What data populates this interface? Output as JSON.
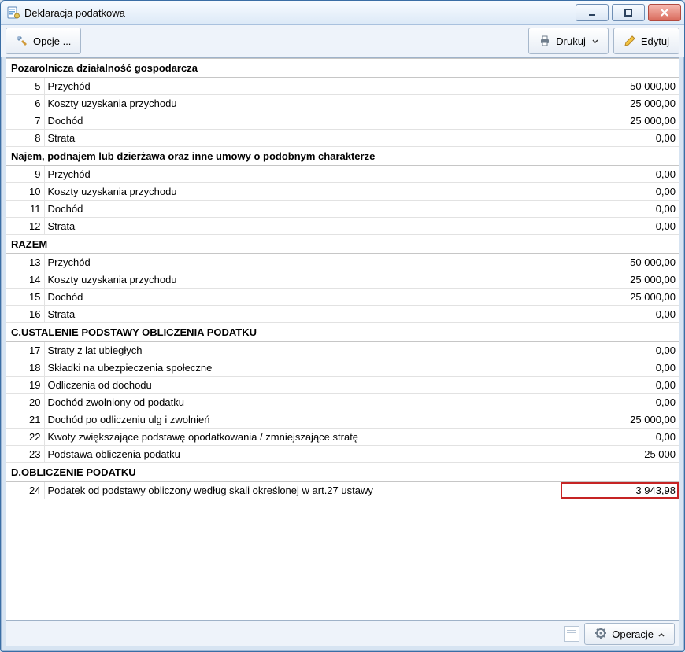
{
  "window": {
    "title": "Deklaracja podatkowa"
  },
  "toolbar": {
    "options_label": "Opcje ...",
    "print_label": "Drukuj",
    "edit_label": "Edytuj"
  },
  "statusbar": {
    "operations_label": "Operacje"
  },
  "sections": [
    {
      "title": "Pozarolnicza działalność gospodarcza",
      "rows": [
        {
          "num": "5",
          "label": "Przychód",
          "value": "50 000,00"
        },
        {
          "num": "6",
          "label": "Koszty uzyskania przychodu",
          "value": "25 000,00"
        },
        {
          "num": "7",
          "label": "Dochód",
          "value": "25 000,00"
        },
        {
          "num": "8",
          "label": "Strata",
          "value": "0,00"
        }
      ]
    },
    {
      "title": "Najem, podnajem lub dzierżawa oraz inne umowy o podobnym charakterze",
      "rows": [
        {
          "num": "9",
          "label": "Przychód",
          "value": "0,00"
        },
        {
          "num": "10",
          "label": "Koszty uzyskania przychodu",
          "value": "0,00"
        },
        {
          "num": "11",
          "label": "Dochód",
          "value": "0,00"
        },
        {
          "num": "12",
          "label": "Strata",
          "value": "0,00"
        }
      ]
    },
    {
      "title": "RAZEM",
      "rows": [
        {
          "num": "13",
          "label": "Przychód",
          "value": "50 000,00"
        },
        {
          "num": "14",
          "label": "Koszty uzyskania przychodu",
          "value": "25 000,00"
        },
        {
          "num": "15",
          "label": "Dochód",
          "value": "25 000,00"
        },
        {
          "num": "16",
          "label": "Strata",
          "value": "0,00"
        }
      ]
    },
    {
      "title": "C.USTALENIE PODSTAWY OBLICZENIA PODATKU",
      "rows": [
        {
          "num": "17",
          "label": "Straty z lat ubiegłych",
          "value": "0,00"
        },
        {
          "num": "18",
          "label": "Składki na ubezpieczenia społeczne",
          "value": "0,00"
        },
        {
          "num": "19",
          "label": "Odliczenia od dochodu",
          "value": "0,00"
        },
        {
          "num": "20",
          "label": "Dochód zwolniony od podatku",
          "value": "0,00"
        },
        {
          "num": "21",
          "label": "Dochód po odliczeniu ulg i zwolnień",
          "value": "25 000,00"
        },
        {
          "num": "22",
          "label": "Kwoty zwiększające podstawę opodatkowania / zmniejszające stratę",
          "value": "0,00"
        },
        {
          "num": "23",
          "label": "Podstawa obliczenia podatku",
          "value": "25 000"
        }
      ]
    },
    {
      "title": "D.OBLICZENIE PODATKU",
      "rows": [
        {
          "num": "24",
          "label": "Podatek od podstawy obliczony według skali określonej w art.27 ustawy",
          "value": "3 943,98",
          "highlight": true
        }
      ]
    }
  ]
}
